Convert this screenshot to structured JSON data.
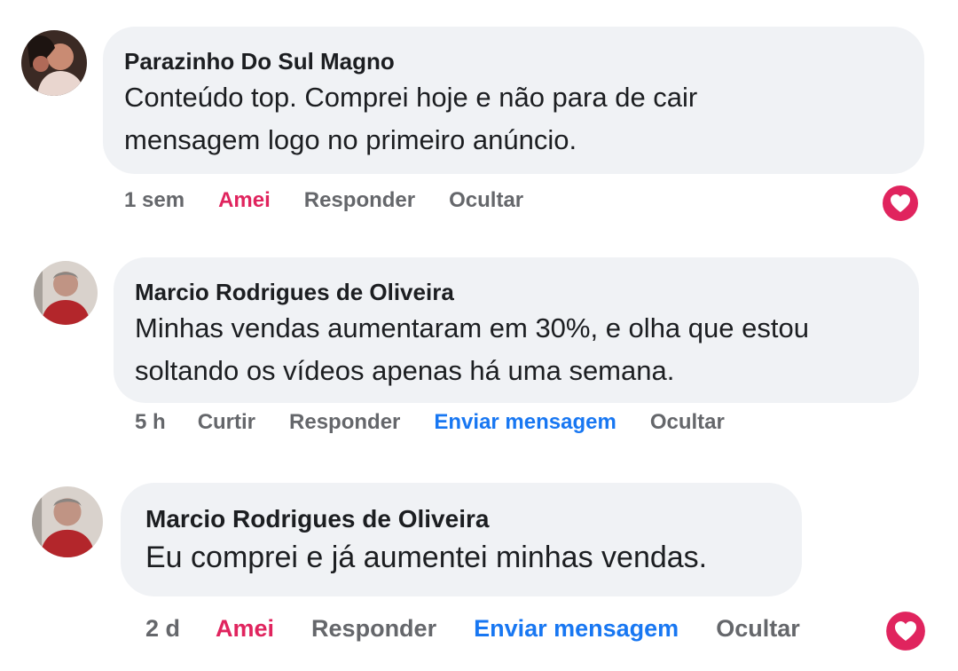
{
  "comments": [
    {
      "author": "Parazinho Do Sul Magno",
      "text": "Conteúdo top. Comprei hoje e não para de cair mensagem logo no primeiro anúncio.",
      "time": "1 sem",
      "reaction_label": "Amei",
      "reply_label": "Responder",
      "hide_label": "Ocultar",
      "reaction_icon": "love-reaction-icon"
    },
    {
      "author": "Marcio Rodrigues de Oliveira",
      "text": "Minhas vendas aumentaram em 30%, e olha que estou soltando os vídeos apenas há uma semana.",
      "time": "5 h",
      "like_label": "Curtir",
      "reply_label": "Responder",
      "message_label": "Enviar mensagem",
      "hide_label": "Ocultar"
    },
    {
      "author": "Marcio Rodrigues de Oliveira",
      "text": "Eu comprei e já aumentei minhas vendas.",
      "time": "2 d",
      "reaction_label": "Amei",
      "reply_label": "Responder",
      "message_label": "Enviar mensagem",
      "hide_label": "Ocultar",
      "reaction_icon": "love-reaction-icon"
    }
  ],
  "colors": {
    "bubble": "#f0f2f5",
    "love": "#e0245e",
    "link_blue": "#1877f2",
    "muted": "#65676b",
    "text": "#1c1e21"
  }
}
